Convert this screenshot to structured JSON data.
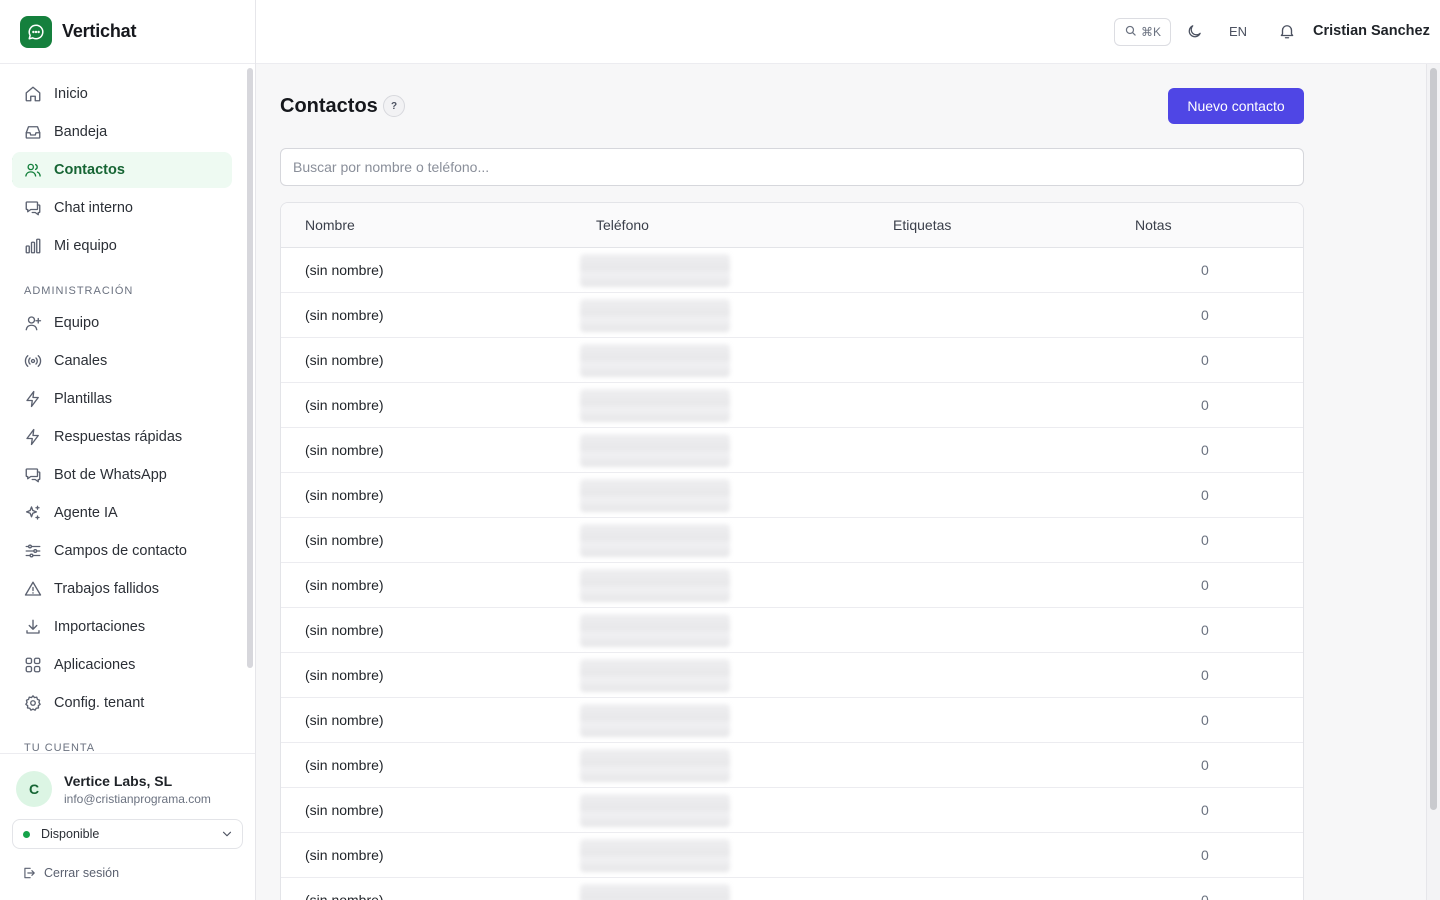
{
  "app": {
    "name": "Vertichat"
  },
  "sidebar": {
    "main_items": [
      {
        "label": "Inicio",
        "icon": "home-icon"
      },
      {
        "label": "Bandeja",
        "icon": "inbox-icon"
      },
      {
        "label": "Contactos",
        "icon": "users-icon",
        "active": true
      },
      {
        "label": "Chat interno",
        "icon": "chat-icon"
      },
      {
        "label": "Mi equipo",
        "icon": "bar-chart-icon"
      }
    ],
    "admin_label": "ADMINISTRACIÓN",
    "admin_items": [
      {
        "label": "Equipo",
        "icon": "user-plus-icon"
      },
      {
        "label": "Canales",
        "icon": "broadcast-icon"
      },
      {
        "label": "Plantillas",
        "icon": "bolt-icon"
      },
      {
        "label": "Respuestas rápidas",
        "icon": "bolt-icon"
      },
      {
        "label": "Bot de WhatsApp",
        "icon": "chat-icon"
      },
      {
        "label": "Agente IA",
        "icon": "sparkles-icon"
      },
      {
        "label": "Campos de contacto",
        "icon": "sliders-icon"
      },
      {
        "label": "Trabajos fallidos",
        "icon": "warning-icon"
      },
      {
        "label": "Importaciones",
        "icon": "download-icon"
      },
      {
        "label": "Aplicaciones",
        "icon": "grid-icon"
      },
      {
        "label": "Config. tenant",
        "icon": "gear-icon"
      }
    ],
    "account_label": "TU CUENTA"
  },
  "account": {
    "avatar_initial": "C",
    "name": "Vertice Labs, SL",
    "email": "info@cristianprograma.com",
    "status": "Disponible",
    "logout": "Cerrar sesión"
  },
  "header": {
    "search_shortcut": "⌘K",
    "language": "EN",
    "user_name": "Cristian Sanchez"
  },
  "page": {
    "title": "Contactos",
    "help": "?",
    "new_button": "Nuevo contacto",
    "search_placeholder": "Buscar por nombre o teléfono..."
  },
  "table": {
    "columns": [
      "Nombre",
      "Teléfono",
      "Etiquetas",
      "Notas"
    ],
    "rows": [
      {
        "name": "(sin nombre)",
        "notes": "0"
      },
      {
        "name": "(sin nombre)",
        "notes": "0"
      },
      {
        "name": "(sin nombre)",
        "notes": "0"
      },
      {
        "name": "(sin nombre)",
        "notes": "0"
      },
      {
        "name": "(sin nombre)",
        "notes": "0"
      },
      {
        "name": "(sin nombre)",
        "notes": "0"
      },
      {
        "name": "(sin nombre)",
        "notes": "0"
      },
      {
        "name": "(sin nombre)",
        "notes": "0"
      },
      {
        "name": "(sin nombre)",
        "notes": "0"
      },
      {
        "name": "(sin nombre)",
        "notes": "0"
      },
      {
        "name": "(sin nombre)",
        "notes": "0"
      },
      {
        "name": "(sin nombre)",
        "notes": "0"
      },
      {
        "name": "(sin nombre)",
        "notes": "0"
      },
      {
        "name": "(sin nombre)",
        "notes": "0"
      },
      {
        "name": "(sin nombre)",
        "notes": "0"
      }
    ]
  },
  "colors": {
    "brand": "#15803d",
    "primary_button": "#4f46e5",
    "active_bg": "#eefaf2"
  }
}
